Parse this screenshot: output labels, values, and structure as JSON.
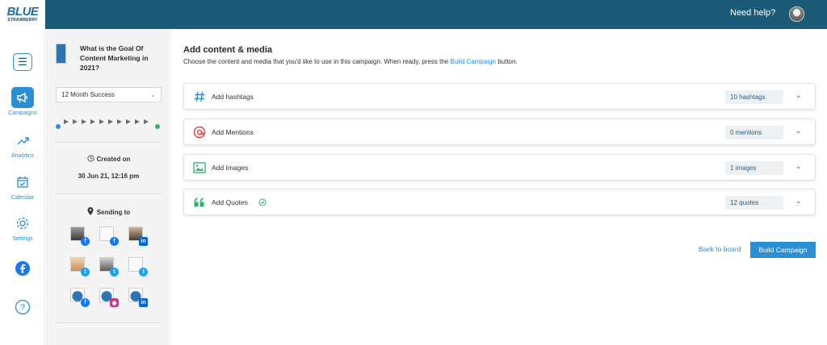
{
  "app": {
    "logo_main": "BLUE",
    "logo_sub": "STRAWBERRY",
    "help_label": "Need help?"
  },
  "nav": {
    "items": [
      {
        "label": "Campaigns",
        "icon": "megaphone-icon",
        "active": true
      },
      {
        "label": "Analytics",
        "icon": "trend-icon"
      },
      {
        "label": "Calendar",
        "icon": "calendar-icon"
      },
      {
        "label": "Settings",
        "icon": "gear-icon"
      }
    ],
    "facebook_icon": "facebook-icon",
    "help_icon": "question-icon"
  },
  "sidebar": {
    "post_title": "What is the Goal Of Content Marketing in 2021?",
    "schedule_select": "12 Month Success",
    "created_label": "Created on",
    "created_value": "30 Jun 21, 12:16 pm",
    "sending_label": "Sending to"
  },
  "main": {
    "title": "Add content & media",
    "subtitle_before": "Choose the content and media that you'd like to use in this campaign. When ready, press the",
    "subtitle_link": "Build Campaign",
    "subtitle_after": "button.",
    "sections": [
      {
        "label": "Add hashtags",
        "count": "10 hashtags",
        "icon": "hashtag-icon"
      },
      {
        "label": "Add Mentions",
        "count": "0 mentions",
        "icon": "at-icon"
      },
      {
        "label": "Add Images",
        "count": "1 images",
        "icon": "image-icon"
      },
      {
        "label": "Add Quotes",
        "count": "12 quotes",
        "icon": "quote-icon"
      }
    ],
    "back_label": "Back to board",
    "build_label": "Build Campaign"
  },
  "colors": {
    "topbar": "#1b5b78",
    "accent": "#2b8fd6",
    "facebook": "#1877f2",
    "twitter": "#1da1f2",
    "linkedin": "#0a66c2",
    "instagram": "#c13584"
  }
}
